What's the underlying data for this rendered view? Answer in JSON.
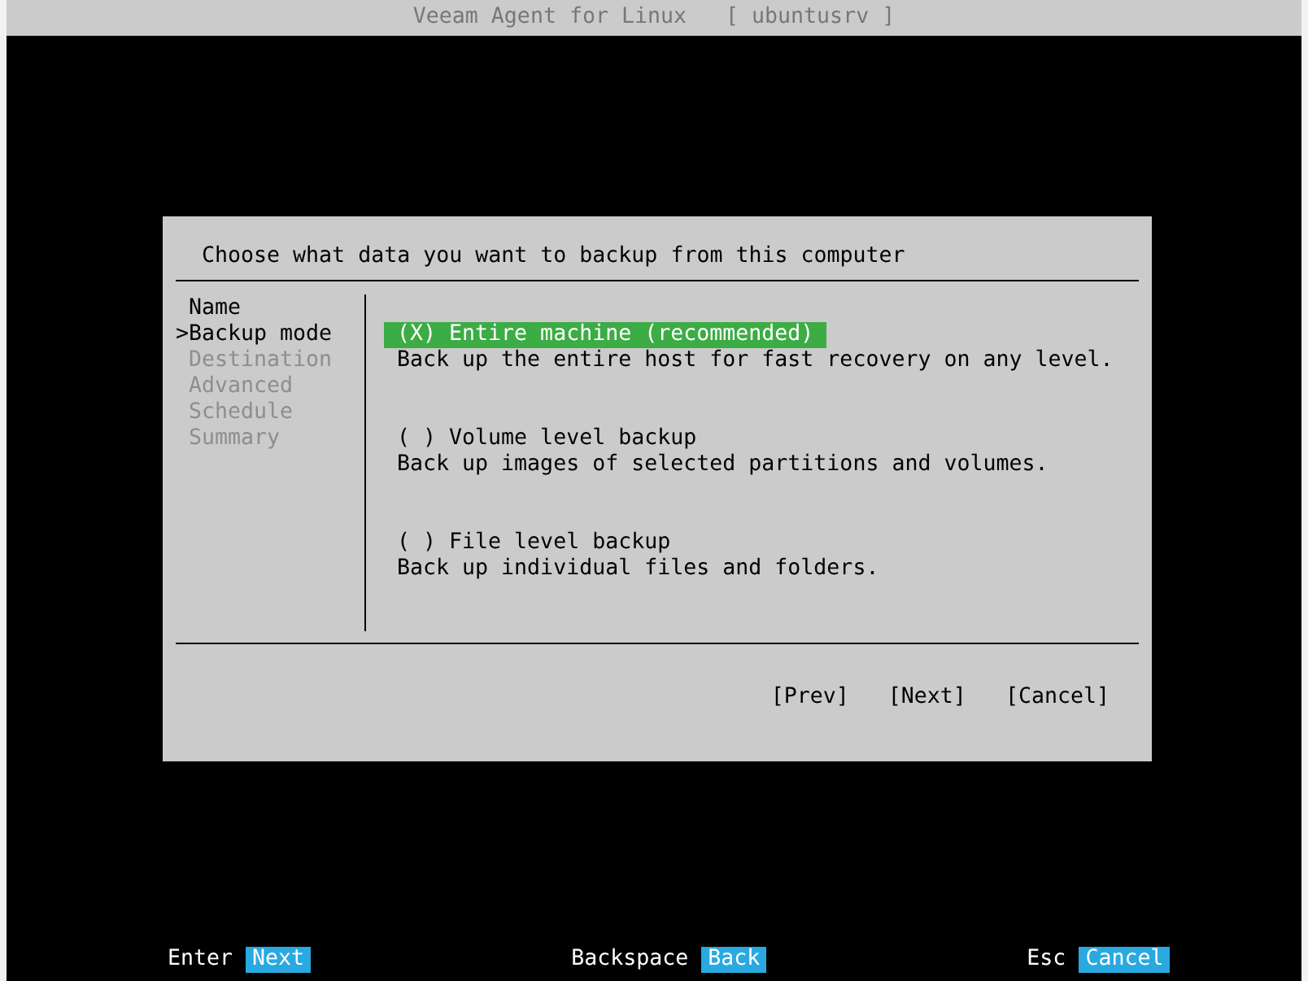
{
  "window": {
    "title": "Veeam Agent for Linux",
    "host": "[ ubuntusrv ]"
  },
  "dialog": {
    "heading": "Choose what data you want to backup from this computer",
    "current_marker": ">",
    "steps": [
      {
        "label": "Name",
        "selected": false,
        "disabled": false
      },
      {
        "label": "Backup mode",
        "selected": true,
        "disabled": false
      },
      {
        "label": "Destination",
        "selected": false,
        "disabled": true
      },
      {
        "label": "Advanced",
        "selected": false,
        "disabled": true
      },
      {
        "label": "Schedule",
        "selected": false,
        "disabled": true
      },
      {
        "label": "Summary",
        "selected": false,
        "disabled": true
      }
    ],
    "options": [
      {
        "label": "(X) Entire machine (recommended)",
        "description": "Back up the entire host for fast recovery on any level.",
        "selected": true
      },
      {
        "label": "( ) Volume level backup",
        "description": "Back up images of selected partitions and volumes.",
        "selected": false
      },
      {
        "label": "( ) File level backup",
        "description": "Back up individual files and folders.",
        "selected": false
      }
    ],
    "buttons": [
      "[Prev]",
      "[Next]",
      "[Cancel]"
    ]
  },
  "hotkeys": [
    {
      "key": "Enter",
      "action": "Next"
    },
    {
      "key": "Backspace",
      "action": "Back"
    },
    {
      "key": "Esc",
      "action": "Cancel"
    }
  ]
}
